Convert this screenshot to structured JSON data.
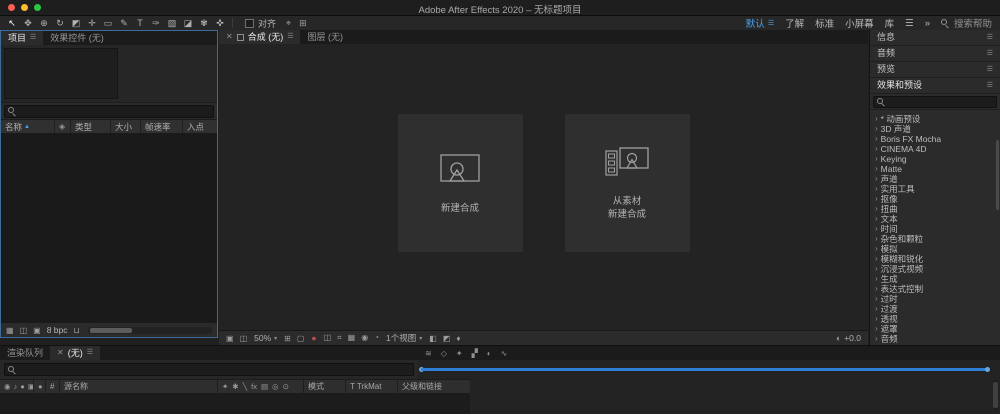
{
  "ui": {
    "menu_glyph": "☰",
    "caret_down": "▾",
    "close_glyph": "✕",
    "chevron_right": "›",
    "sort_asc": "▲",
    "label_glyph": "●",
    "overflow_glyph": "»"
  },
  "colors": {
    "accent_blue": "#3f8fd2",
    "workspace_active": "#4b9fe8"
  },
  "titlebar": {
    "title": "Adobe After Effects 2020 – 无标题项目"
  },
  "toolbar": {
    "tools": [
      {
        "name": "selection-tool-icon",
        "glyph": "↖"
      },
      {
        "name": "hand-tool-icon",
        "glyph": "✥"
      },
      {
        "name": "zoom-tool-icon",
        "glyph": "⊕"
      },
      {
        "name": "rotation-tool-icon",
        "glyph": "↻"
      },
      {
        "name": "camera-tool-icon",
        "glyph": "◩"
      },
      {
        "name": "pan-behind-tool-icon",
        "glyph": "✛"
      },
      {
        "name": "shape-tool-icon",
        "glyph": "▭"
      },
      {
        "name": "pen-tool-icon",
        "glyph": "✎"
      },
      {
        "name": "type-tool-icon",
        "glyph": "T"
      },
      {
        "name": "brush-tool-icon",
        "glyph": "✑"
      },
      {
        "name": "clone-stamp-tool-icon",
        "glyph": "▨"
      },
      {
        "name": "eraser-tool-icon",
        "glyph": "◪"
      },
      {
        "name": "roto-brush-tool-icon",
        "glyph": "✾"
      },
      {
        "name": "puppet-pin-tool-icon",
        "glyph": "✜"
      }
    ],
    "snap_label": "对齐",
    "snap_icons": [
      {
        "name": "snap-options-icon",
        "glyph": "⌖"
      },
      {
        "name": "grid-options-icon",
        "glyph": "⊞"
      }
    ],
    "workspaces": [
      "默认",
      "了解",
      "标准",
      "小屏幕",
      "库"
    ],
    "search_label": "搜索帮助"
  },
  "project_panel": {
    "tab_project": "项目",
    "tab_effect_controls": "效果控件 (无)",
    "columns": [
      "名称",
      "类型",
      "大小",
      "帧速率",
      "入点"
    ],
    "label_column_icon": {
      "name": "label-icon",
      "glyph": "◈"
    },
    "bottom_icons": [
      {
        "name": "thumbnail-view-icon",
        "glyph": "▦"
      },
      {
        "name": "new-folder-icon",
        "glyph": "◫"
      },
      {
        "name": "new-composition-icon",
        "glyph": "▣"
      }
    ],
    "bit_depth": "8 bpc",
    "trash_icon": {
      "name": "delete-icon",
      "glyph": "⊔"
    }
  },
  "comp_panel": {
    "tab_composition": "合成 (无)",
    "tab_layer": "图层 (无)",
    "new_comp_label": "新建合成",
    "new_comp_footage_label": "从素材\n新建合成",
    "icons_a": [
      {
        "name": "snapshot-icon",
        "glyph": "▣"
      },
      {
        "name": "show-snapshot-icon",
        "glyph": "◫"
      }
    ],
    "zoom_value": "50%",
    "icons_b": [
      {
        "name": "grid-guides-icon",
        "glyph": "⊞"
      },
      {
        "name": "mask-visibility-icon",
        "glyph": "▢"
      }
    ],
    "channel_glyph": "●",
    "icons_c": [
      {
        "name": "resolution-icon",
        "glyph": "◫"
      },
      {
        "name": "region-of-interest-icon",
        "glyph": "⌗"
      },
      {
        "name": "transparency-grid-icon",
        "glyph": "▦"
      },
      {
        "name": "camera-view-icon",
        "glyph": "◉"
      },
      {
        "name": "timecode-icon",
        "glyph": "◔"
      }
    ],
    "view_count": "1个视图",
    "icons_d": [
      {
        "name": "pixel-aspect-icon",
        "glyph": "◧"
      },
      {
        "name": "fast-preview-icon",
        "glyph": "◩"
      },
      {
        "name": "draft-3d-icon",
        "glyph": "♦"
      }
    ],
    "exposure_glyph": "◐",
    "exposure": "+0.0"
  },
  "right_panel": {
    "sections": [
      "信息",
      "音频",
      "预览"
    ],
    "effects_header": "效果和预设",
    "categories": [
      "* 动画预设",
      "3D 声道",
      "Boris FX Mocha",
      "CINEMA 4D",
      "Keying",
      "Matte",
      "声道",
      "实用工具",
      "抠像",
      "扭曲",
      "文本",
      "时间",
      "杂色和颗粒",
      "模拟",
      "模糊和锐化",
      "沉浸式视频",
      "生成",
      "表达式控制",
      "过时",
      "过渡",
      "透视",
      "遮罩",
      "音频"
    ]
  },
  "timeline": {
    "tab_render_queue": "渲染队列",
    "tab_comp": "(无)",
    "ruler_icons": [
      {
        "name": "comp-mini-flowchart-icon",
        "glyph": "≋"
      },
      {
        "name": "draft-3d-icon",
        "glyph": "◇"
      },
      {
        "name": "hide-shy-icon",
        "glyph": "✦"
      },
      {
        "name": "frame-blend-icon",
        "glyph": "▞"
      },
      {
        "name": "motion-blur-icon",
        "glyph": "◐"
      },
      {
        "name": "graph-editor-icon",
        "glyph": "∿"
      }
    ],
    "av_icons": [
      {
        "name": "eye-icon",
        "glyph": "◉"
      },
      {
        "name": "audio-icon",
        "glyph": "♪"
      },
      {
        "name": "solo-icon",
        "glyph": "●"
      },
      {
        "name": "lock-icon",
        "glyph": "▣"
      }
    ],
    "hash_label": "#",
    "col_source_name": "源名称",
    "switch_icons": [
      {
        "name": "shy-icon",
        "glyph": "✦"
      },
      {
        "name": "collapse-icon",
        "glyph": "✱"
      },
      {
        "name": "quality-icon",
        "glyph": "╲"
      },
      {
        "name": "fx-icon",
        "glyph": "fx"
      },
      {
        "name": "frame-blend-icon",
        "glyph": "▤"
      },
      {
        "name": "motion-blur-icon",
        "glyph": "◎"
      },
      {
        "name": "3d-layer-icon",
        "glyph": "⊙"
      }
    ],
    "col_mode": "模式",
    "col_trkmat": "T TrkMat",
    "col_parent": "父级和链接"
  }
}
